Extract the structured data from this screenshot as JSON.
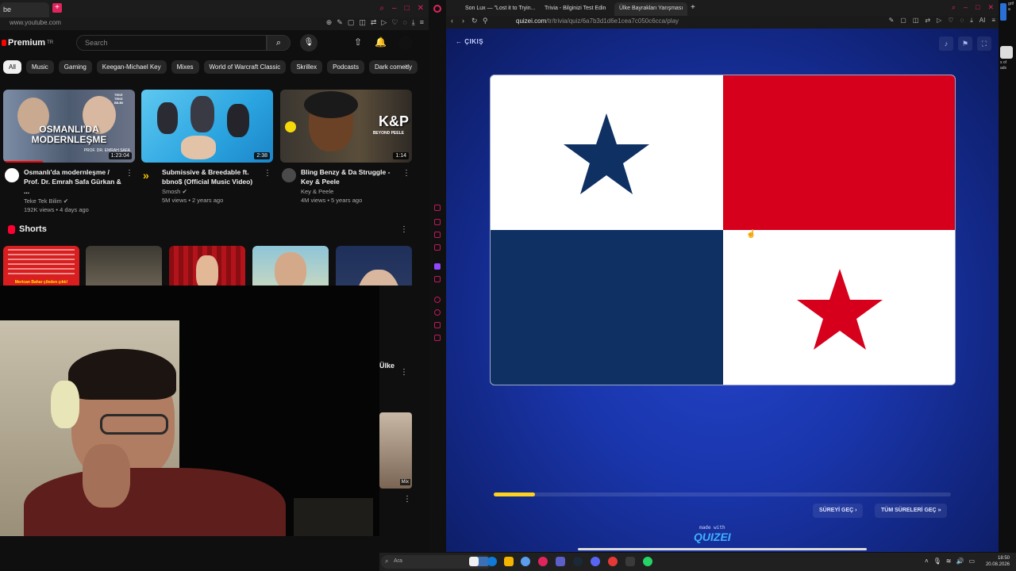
{
  "left_browser": {
    "tab_title": "be",
    "url": "www.youtube.com"
  },
  "youtube": {
    "logo": "Premium",
    "logo_badge": "TR",
    "search_placeholder": "Search",
    "chips": [
      "All",
      "Music",
      "Gaming",
      "Keegan-Michael Key",
      "Mixes",
      "World of Warcraft Classic",
      "Skrillex",
      "Podcasts",
      "Dark comedy"
    ],
    "videos": [
      {
        "title": "Osmanlı'da modernleşme / Prof. Dr. Emrah Safa Gürkan & ...",
        "channel": "Teke Tek Bilim",
        "meta": "192K views • 4 days ago",
        "duration": "1:23:04",
        "thumb_text": "OSMANLI'DA MODERNLEŞME",
        "thumb_sub": "PROF. DR. EMRAH SAFA",
        "thumb_tag": "TEKE TEKE BİLİM"
      },
      {
        "title": "Submissive & Breedable ft. bbno$ (Official Music Video)",
        "channel": "Smosh",
        "meta": "5M views • 2 years ago",
        "duration": "2:38"
      },
      {
        "title": "Bling Benzy & Da Struggle - Key & Peele",
        "channel": "Key & Peele",
        "meta": "4M views • 5 years ago",
        "duration": "1:14",
        "thumb_text": "K&P",
        "thumb_sub": "BEYOND PEELE"
      }
    ],
    "shorts_title": "Shorts",
    "short1_text": "Mertcan Bahar çileden çıktı!",
    "partial_title": "Ülke",
    "mix_label": "Mix"
  },
  "right_browser": {
    "tabs": [
      "Son Lux — \"Lost it to Tryin...",
      "Trivia - Bilginizi Test Edin",
      "Ülke Bayrakları Yarışması"
    ],
    "url_host": "quizei.com",
    "url_path": "/tr/trivia/quiz/6a7b3d1d6e1cea7c050c6cca/play"
  },
  "quiz": {
    "exit_label": "ÇIKIŞ",
    "skip_label": "SÜREYİ GEÇ",
    "skip_all_label": "TÜM SÜRELERİ GEÇ",
    "made_with": "made with",
    "brand": "QUIZEI",
    "progress": 0.09,
    "flag_colors": {
      "blue": "#0f3063",
      "red": "#d6001c",
      "white": "#ffffff"
    }
  },
  "right_edge": {
    "lines": [
      "grif",
      "a",
      "s of",
      "ads"
    ]
  },
  "taskbar": {
    "search": "Ara",
    "time": "18:50",
    "date": "20.08.2026"
  }
}
